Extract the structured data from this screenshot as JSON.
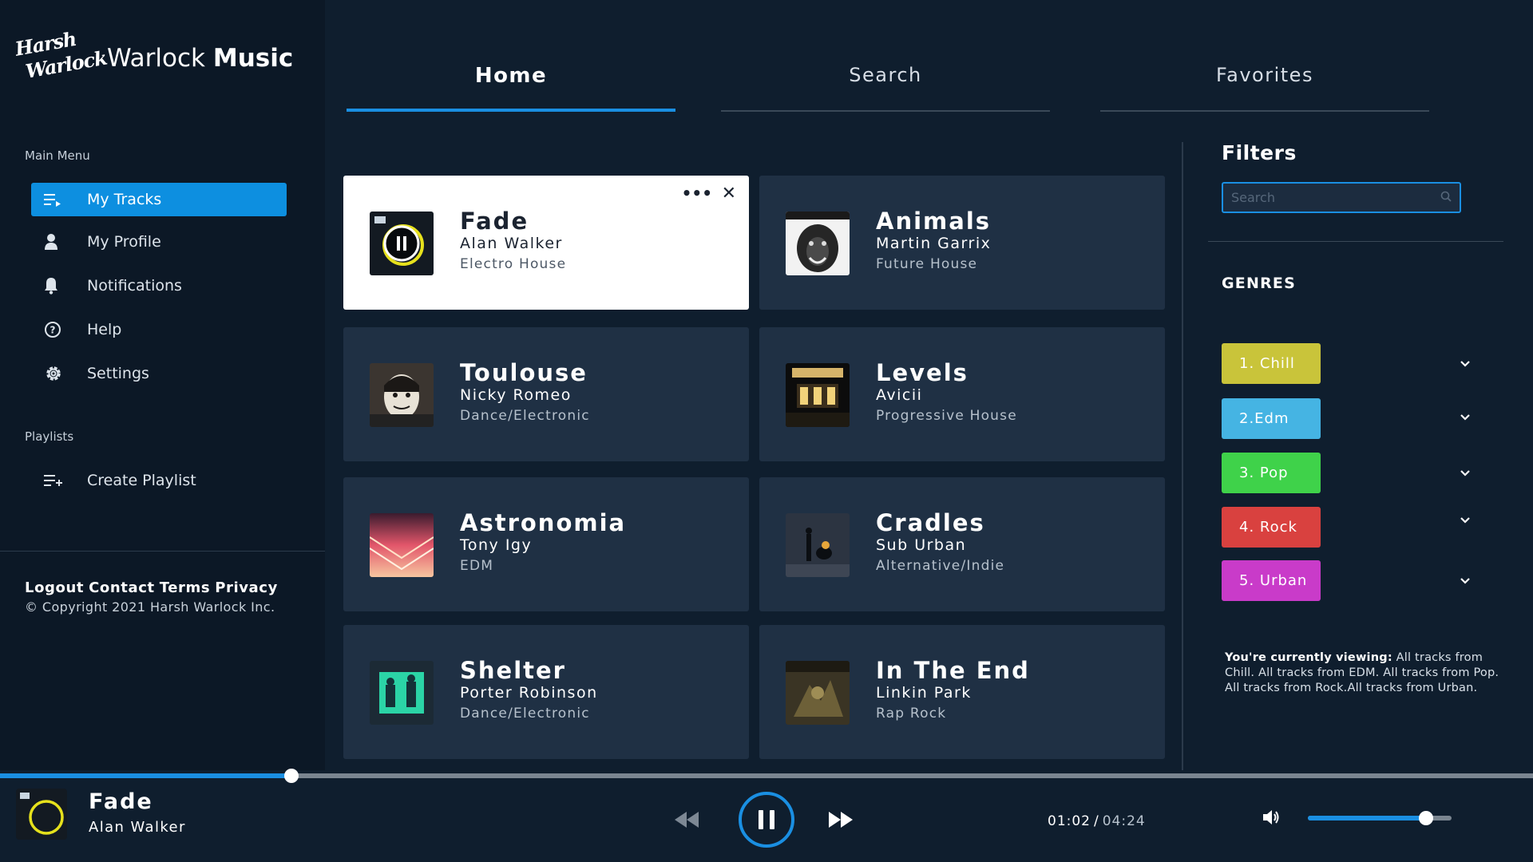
{
  "brand": {
    "logo_line1": "Harsh",
    "logo_line2": "Warlock",
    "name_regular": "Warlock",
    "name_bold": "Music"
  },
  "sidebar": {
    "main_menu_label": "Main Menu",
    "items": [
      {
        "label": "My Tracks",
        "icon": "playlist-icon",
        "active": true
      },
      {
        "label": "My Profile",
        "icon": "user-icon",
        "active": false
      },
      {
        "label": "Notifications",
        "icon": "bell-icon",
        "active": false
      },
      {
        "label": "Help",
        "icon": "help-icon",
        "active": false
      },
      {
        "label": "Settings",
        "icon": "gear-icon",
        "active": false
      }
    ],
    "playlists_label": "Playlists",
    "create_playlist": "Create Playlist",
    "footer_links": [
      "Logout",
      "Contact",
      "Terms",
      "Privacy"
    ],
    "copyright": "© Copyright 2021 Harsh Warlock Inc."
  },
  "tabs": [
    {
      "label": "Home",
      "active": true
    },
    {
      "label": "Search",
      "active": false
    },
    {
      "label": "Favorites",
      "active": false
    }
  ],
  "tracks": [
    {
      "title": "Fade",
      "artist": "Alan Walker",
      "genre": "Electro House",
      "selected": true,
      "playing": true
    },
    {
      "title": "Animals",
      "artist": "Martin Garrix",
      "genre": "Future House",
      "selected": false
    },
    {
      "title": "Toulouse",
      "artist": "Nicky Romeo",
      "genre": "Dance/Electronic",
      "selected": false
    },
    {
      "title": "Levels",
      "artist": "Avicii",
      "genre": "Progressive House",
      "selected": false
    },
    {
      "title": "Astronomia",
      "artist": "Tony Igy",
      "genre": "EDM",
      "selected": false
    },
    {
      "title": "Cradles",
      "artist": "Sub Urban",
      "genre": "Alternative/Indie",
      "selected": false
    },
    {
      "title": "Shelter",
      "artist": "Porter Robinson",
      "genre": "Dance/Electronic",
      "selected": false
    },
    {
      "title": "In The End",
      "artist": "Linkin Park",
      "genre": "Rap Rock",
      "selected": false
    }
  ],
  "card_menu": {
    "more": "•••",
    "close": "✕"
  },
  "filters": {
    "title": "Filters",
    "search_placeholder": "Search",
    "search_value": "",
    "genres_title": "GENRES",
    "genres": [
      {
        "label": "1. Chill",
        "color": "#c9c43a"
      },
      {
        "label": "2.Edm",
        "color": "#45b4e3"
      },
      {
        "label": "3. Pop",
        "color": "#3fd24a"
      },
      {
        "label": "4. Rock",
        "color": "#d9413f"
      },
      {
        "label": "5. Urban",
        "color": "#c93bc9"
      }
    ],
    "viewing_label": "You're currently viewing:",
    "viewing_text": "All tracks from Chill. All tracks from EDM. All tracks from Pop. All tracks from Rock.All tracks from Urban."
  },
  "player": {
    "title": "Fade",
    "artist": "Alan Walker",
    "current_time": "01:02",
    "separator": "/",
    "duration": "04:24",
    "progress": 0.19,
    "volume": 0.82,
    "state": "playing"
  },
  "colors": {
    "accent": "#1a8fe2",
    "background": "#0f1e2e",
    "sidebar": "#0c1826",
    "card": "#1f3044"
  }
}
